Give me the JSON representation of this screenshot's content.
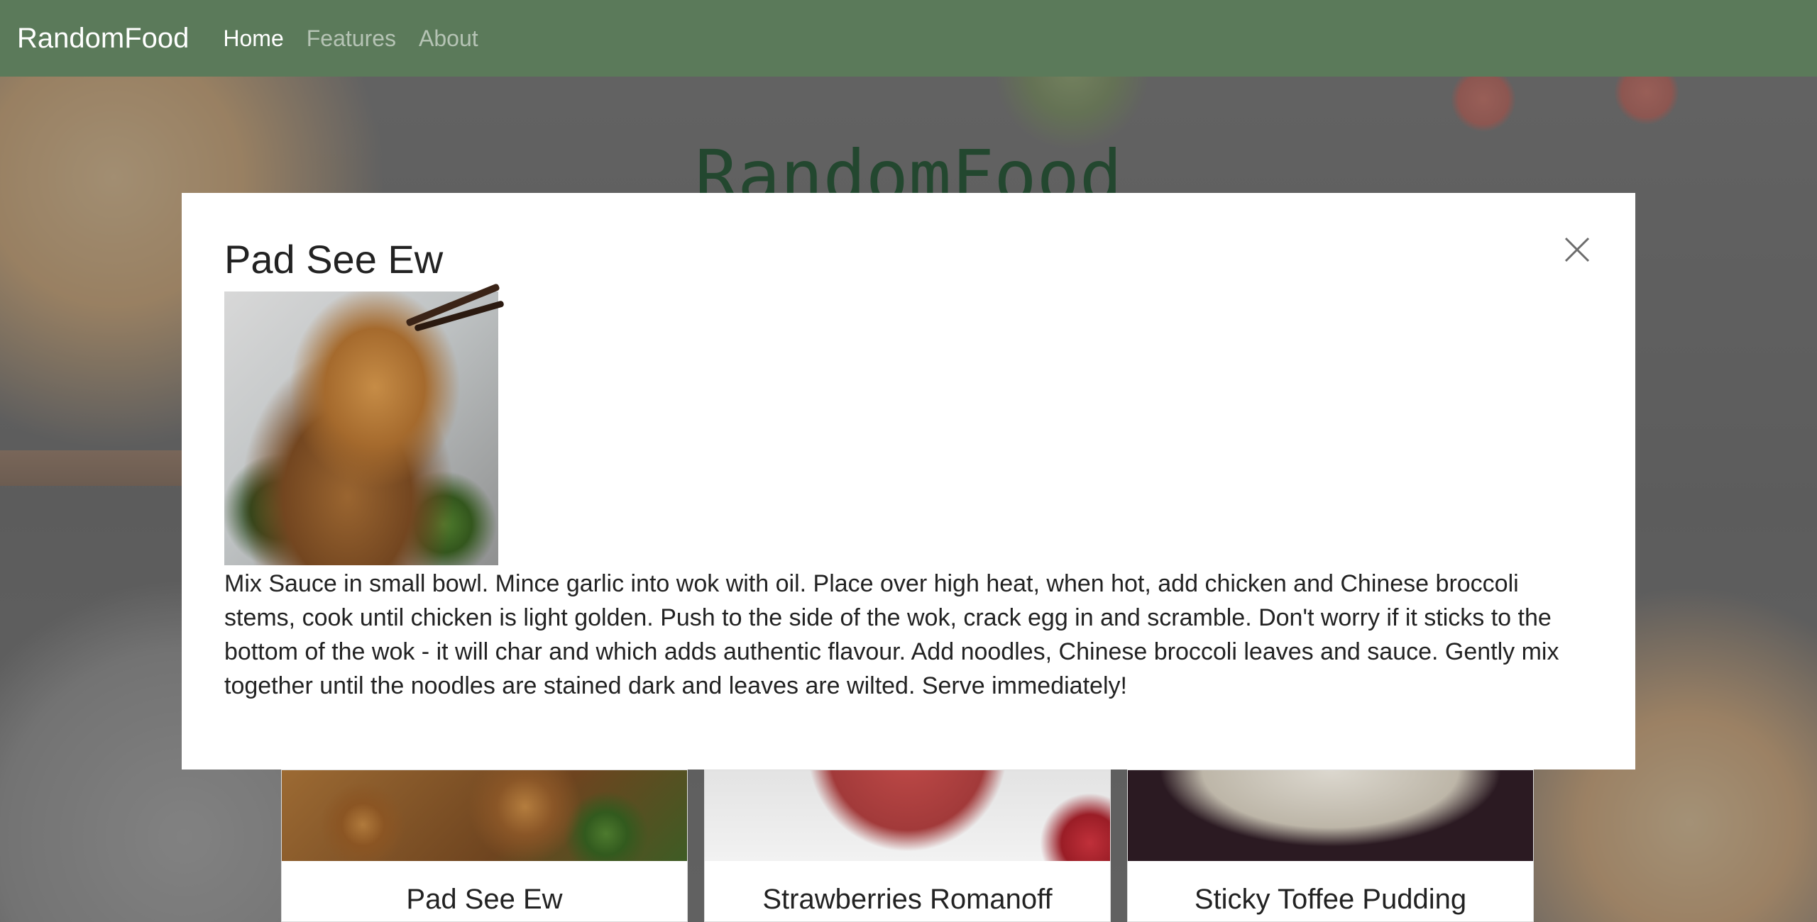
{
  "navbar": {
    "brand": "RandomFood",
    "links": [
      {
        "label": "Home",
        "active": true
      },
      {
        "label": "Features",
        "active": false
      },
      {
        "label": "About",
        "active": false
      }
    ]
  },
  "hero": {
    "title": "RandomFood"
  },
  "modal": {
    "title": "Pad See Ew",
    "close_icon": "close-icon",
    "instructions": "Mix Sauce in small bowl. Mince garlic into wok with oil. Place over high heat, when hot, add chicken and Chinese broccoli stems, cook until chicken is light golden. Push to the side of the wok, crack egg in and scramble. Don't worry if it sticks to the bottom of the wok - it will char and which adds authentic flavour. Add noodles, Chinese broccoli leaves and sauce. Gently mix together until the noodles are stained dark and leaves are wilted. Serve immediately!"
  },
  "cards": [
    {
      "title": "Pad See Ew"
    },
    {
      "title": "Strawberries Romanoff"
    },
    {
      "title": "Sticky Toffee Pudding"
    }
  ],
  "colors": {
    "navbar": "#5b7a5a",
    "hero_title": "#23472f"
  }
}
